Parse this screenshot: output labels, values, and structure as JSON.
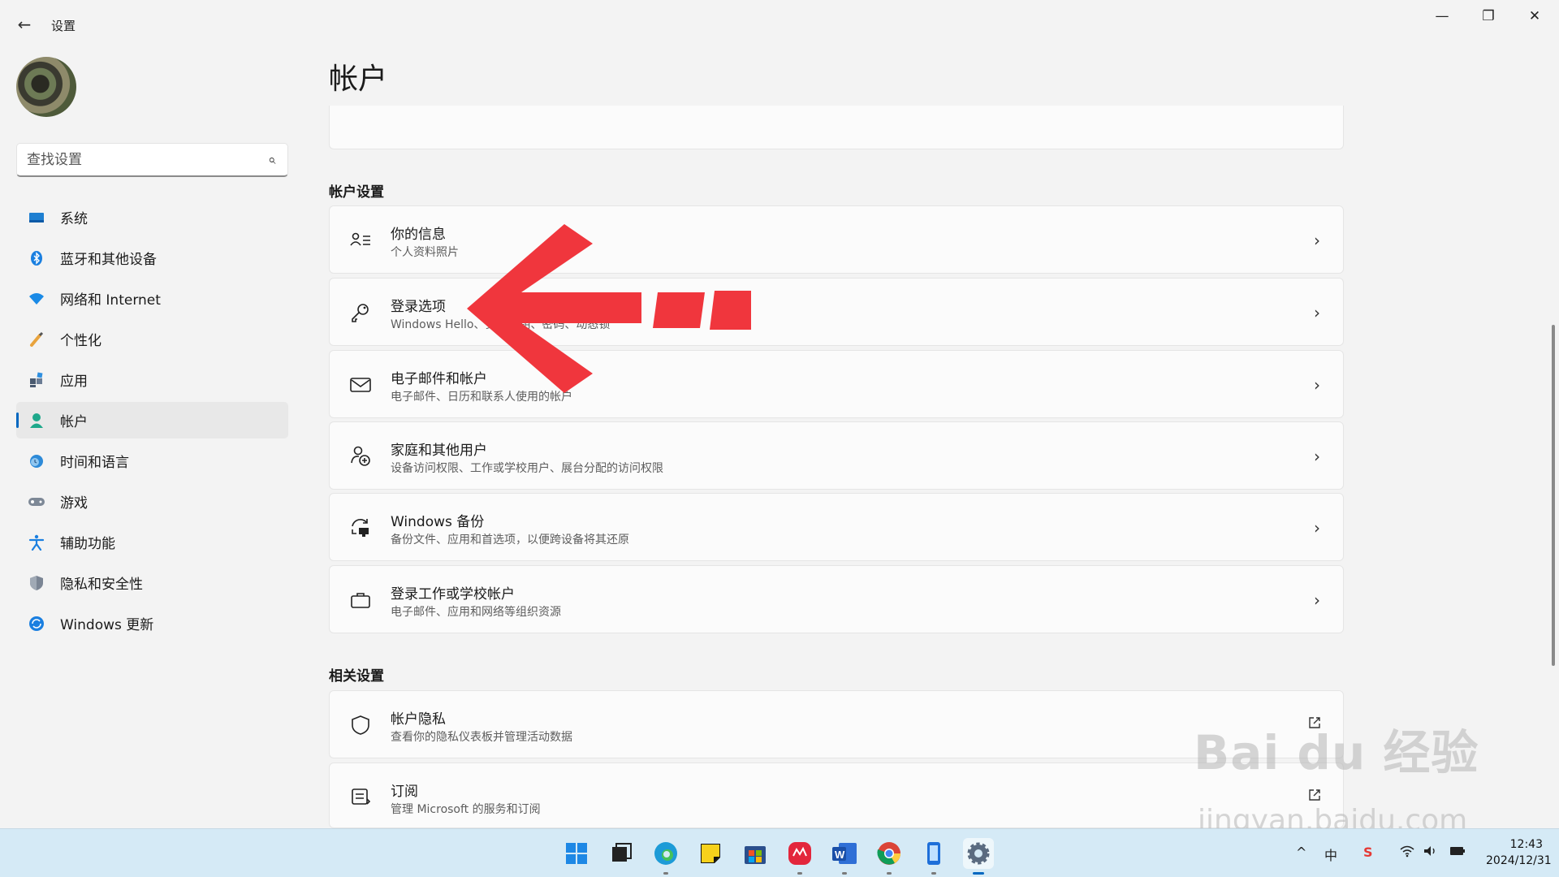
{
  "window": {
    "title": "设置",
    "back_icon": "back-arrow-icon",
    "minimize": "—",
    "maximize": "❐",
    "close": "✕"
  },
  "sidebar": {
    "search_placeholder": "查找设置",
    "items": [
      {
        "label": "系统",
        "icon": "system-icon"
      },
      {
        "label": "蓝牙和其他设备",
        "icon": "bluetooth-icon"
      },
      {
        "label": "网络和 Internet",
        "icon": "wifi-icon"
      },
      {
        "label": "个性化",
        "icon": "brush-icon"
      },
      {
        "label": "应用",
        "icon": "apps-icon"
      },
      {
        "label": "帐户",
        "icon": "account-icon",
        "active": true
      },
      {
        "label": "时间和语言",
        "icon": "globe-clock-icon"
      },
      {
        "label": "游戏",
        "icon": "gamepad-icon"
      },
      {
        "label": "辅助功能",
        "icon": "accessibility-icon"
      },
      {
        "label": "隐私和安全性",
        "icon": "shield-icon"
      },
      {
        "label": "Windows 更新",
        "icon": "update-icon"
      }
    ]
  },
  "main": {
    "title": "帐户",
    "account_settings_heading": "帐户设置",
    "account_settings": [
      {
        "title": "你的信息",
        "subtitle": "个人资料照片",
        "icon": "person-info-icon"
      },
      {
        "title": "登录选项",
        "subtitle": "Windows Hello、安全密钥、密码、动态锁",
        "icon": "key-icon"
      },
      {
        "title": "电子邮件和帐户",
        "subtitle": "电子邮件、日历和联系人使用的帐户",
        "icon": "mail-icon"
      },
      {
        "title": "家庭和其他用户",
        "subtitle": "设备访问权限、工作或学校用户、展台分配的访问权限",
        "icon": "add-person-icon"
      },
      {
        "title": "Windows 备份",
        "subtitle": "备份文件、应用和首选项，以便跨设备将其还原",
        "icon": "backup-icon"
      },
      {
        "title": "登录工作或学校帐户",
        "subtitle": "电子邮件、应用和网络等组织资源",
        "icon": "briefcase-icon"
      }
    ],
    "related_heading": "相关设置",
    "related": [
      {
        "title": "帐户隐私",
        "subtitle": "查看你的隐私仪表板并管理活动数据",
        "icon": "shield-outline-icon"
      },
      {
        "title": "订阅",
        "subtitle": "管理 Microsoft 的服务和订阅",
        "icon": "subscription-icon"
      }
    ]
  },
  "watermark": {
    "line1": "Bai du 经验",
    "line2": "jingyan.baidu.com"
  },
  "taskbar": {
    "apps": [
      "start-icon",
      "taskview-icon",
      "edge-icon",
      "sticky-notes-icon",
      "store-icon",
      "app-red-icon",
      "word-icon",
      "chrome-icon",
      "phone-link-icon",
      "settings-icon"
    ],
    "tray": {
      "chevron": "^",
      "ime": "中",
      "sogou": "S",
      "time": "12:43",
      "date": "2024/12/31"
    }
  },
  "colors": {
    "accent": "#0067c0",
    "arrow": "#f0363d",
    "taskbar": "#d5eaf6"
  }
}
